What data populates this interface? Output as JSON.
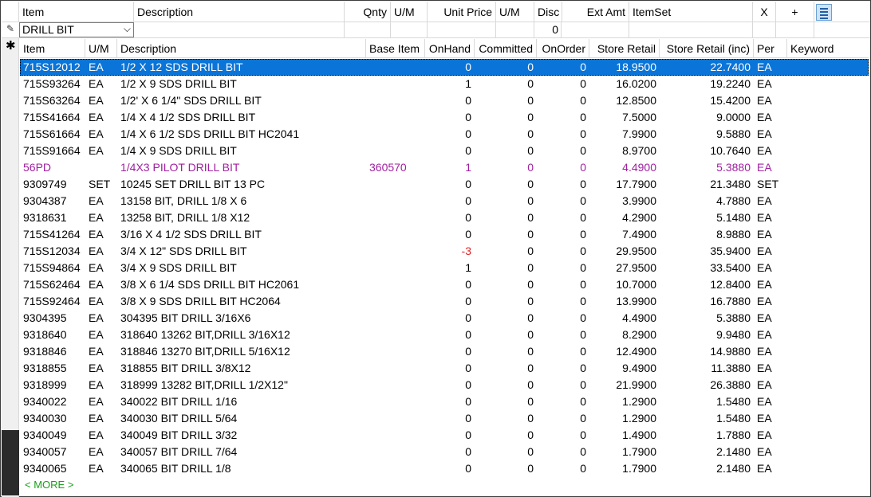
{
  "top_header": {
    "item": "Item",
    "description": "Description",
    "qnty": "Qnty",
    "um": "U/M",
    "unit_price": "Unit Price",
    "um2": "U/M",
    "disc": "Disc",
    "ext_amt": "Ext Amt",
    "itemset": "ItemSet",
    "close": "X",
    "add": "+",
    "menu_icon": "hamburger-menu-icon"
  },
  "entry": {
    "item_value": "DRILL BIT",
    "disc_value": "0"
  },
  "grid": {
    "columns": [
      "Item",
      "U/M",
      "Description",
      "Base Item",
      "OnHand",
      "Committed",
      "OnOrder",
      "Store Retail",
      "Store Retail (inc)",
      "Per",
      "Keyword"
    ],
    "rows": [
      {
        "item": "715S12012",
        "um": "EA",
        "desc": "1/2 X 12 SDS DRILL BIT",
        "base": "",
        "onhand": "0",
        "committed": "0",
        "onorder": "0",
        "retail": "18.9500",
        "retail_inc": "22.7400",
        "per": "EA",
        "keyword": ""
      },
      {
        "item": "715S93264",
        "um": "EA",
        "desc": "1/2 X 9 SDS DRILL BIT",
        "base": "",
        "onhand": "1",
        "committed": "0",
        "onorder": "0",
        "retail": "16.0200",
        "retail_inc": "19.2240",
        "per": "EA",
        "keyword": ""
      },
      {
        "item": "715S63264",
        "um": "EA",
        "desc": "1/2' X 6 1/4\" SDS DRILL BIT",
        "base": "",
        "onhand": "0",
        "committed": "0",
        "onorder": "0",
        "retail": "12.8500",
        "retail_inc": "15.4200",
        "per": "EA",
        "keyword": ""
      },
      {
        "item": "715S41664",
        "um": "EA",
        "desc": "1/4 X 4 1/2 SDS DRILL BIT",
        "base": "",
        "onhand": "0",
        "committed": "0",
        "onorder": "0",
        "retail": "7.5000",
        "retail_inc": "9.0000",
        "per": "EA",
        "keyword": ""
      },
      {
        "item": "715S61664",
        "um": "EA",
        "desc": "1/4 X 6 1/2 SDS DRILL BIT HC2041",
        "base": "",
        "onhand": "0",
        "committed": "0",
        "onorder": "0",
        "retail": "7.9900",
        "retail_inc": "9.5880",
        "per": "EA",
        "keyword": ""
      },
      {
        "item": "715S91664",
        "um": "EA",
        "desc": "1/4 X 9 SDS DRILL BIT",
        "base": "",
        "onhand": "0",
        "committed": "0",
        "onorder": "0",
        "retail": "8.9700",
        "retail_inc": "10.7640",
        "per": "EA",
        "keyword": ""
      },
      {
        "item": "56PD",
        "um": "",
        "desc": "1/4X3 PILOT DRILL BIT",
        "base": "360570",
        "onhand": "1",
        "committed": "0",
        "onorder": "0",
        "retail": "4.4900",
        "retail_inc": "5.3880",
        "per": "EA",
        "keyword": ""
      },
      {
        "item": "9309749",
        "um": "SET",
        "desc": "10245 SET DRILL BIT 13 PC",
        "base": "",
        "onhand": "0",
        "committed": "0",
        "onorder": "0",
        "retail": "17.7900",
        "retail_inc": "21.3480",
        "per": "SET",
        "keyword": ""
      },
      {
        "item": "9304387",
        "um": "EA",
        "desc": "13158 BIT, DRILL 1/8 X 6",
        "base": "",
        "onhand": "0",
        "committed": "0",
        "onorder": "0",
        "retail": "3.9900",
        "retail_inc": "4.7880",
        "per": "EA",
        "keyword": ""
      },
      {
        "item": "9318631",
        "um": "EA",
        "desc": "13258 BIT, DRILL 1/8 X12",
        "base": "",
        "onhand": "0",
        "committed": "0",
        "onorder": "0",
        "retail": "4.2900",
        "retail_inc": "5.1480",
        "per": "EA",
        "keyword": ""
      },
      {
        "item": "715S41264",
        "um": "EA",
        "desc": "3/16 X 4 1/2 SDS DRILL BIT",
        "base": "",
        "onhand": "0",
        "committed": "0",
        "onorder": "0",
        "retail": "7.4900",
        "retail_inc": "8.9880",
        "per": "EA",
        "keyword": ""
      },
      {
        "item": "715S12034",
        "um": "EA",
        "desc": "3/4 X 12\" SDS DRILL BIT",
        "base": "",
        "onhand": "-3",
        "committed": "0",
        "onorder": "0",
        "retail": "29.9500",
        "retail_inc": "35.9400",
        "per": "EA",
        "keyword": ""
      },
      {
        "item": "715S94864",
        "um": "EA",
        "desc": "3/4 X 9 SDS DRILL BIT",
        "base": "",
        "onhand": "1",
        "committed": "0",
        "onorder": "0",
        "retail": "27.9500",
        "retail_inc": "33.5400",
        "per": "EA",
        "keyword": ""
      },
      {
        "item": "715S62464",
        "um": "EA",
        "desc": "3/8 X 6 1/4 SDS DRILL BIT HC2061",
        "base": "",
        "onhand": "0",
        "committed": "0",
        "onorder": "0",
        "retail": "10.7000",
        "retail_inc": "12.8400",
        "per": "EA",
        "keyword": ""
      },
      {
        "item": "715S92464",
        "um": "EA",
        "desc": "3/8 X 9 SDS DRILL BIT HC2064",
        "base": "",
        "onhand": "0",
        "committed": "0",
        "onorder": "0",
        "retail": "13.9900",
        "retail_inc": "16.7880",
        "per": "EA",
        "keyword": ""
      },
      {
        "item": "9304395",
        "um": "EA",
        "desc": "304395 BIT DRILL 3/16X6",
        "base": "",
        "onhand": "0",
        "committed": "0",
        "onorder": "0",
        "retail": "4.4900",
        "retail_inc": "5.3880",
        "per": "EA",
        "keyword": ""
      },
      {
        "item": "9318640",
        "um": "EA",
        "desc": "318640 13262 BIT,DRILL 3/16X12",
        "base": "",
        "onhand": "0",
        "committed": "0",
        "onorder": "0",
        "retail": "8.2900",
        "retail_inc": "9.9480",
        "per": "EA",
        "keyword": ""
      },
      {
        "item": "9318846",
        "um": "EA",
        "desc": "318846 13270 BIT,DRILL 5/16X12",
        "base": "",
        "onhand": "0",
        "committed": "0",
        "onorder": "0",
        "retail": "12.4900",
        "retail_inc": "14.9880",
        "per": "EA",
        "keyword": ""
      },
      {
        "item": "9318855",
        "um": "EA",
        "desc": "318855 BIT DRILL 3/8X12",
        "base": "",
        "onhand": "0",
        "committed": "0",
        "onorder": "0",
        "retail": "9.4900",
        "retail_inc": "11.3880",
        "per": "EA",
        "keyword": ""
      },
      {
        "item": "9318999",
        "um": "EA",
        "desc": "318999 13282 BIT,DRILL 1/2X12\"",
        "base": "",
        "onhand": "0",
        "committed": "0",
        "onorder": "0",
        "retail": "21.9900",
        "retail_inc": "26.3880",
        "per": "EA",
        "keyword": ""
      },
      {
        "item": "9340022",
        "um": "EA",
        "desc": "340022 BIT DRILL 1/16",
        "base": "",
        "onhand": "0",
        "committed": "0",
        "onorder": "0",
        "retail": "1.2900",
        "retail_inc": "1.5480",
        "per": "EA",
        "keyword": ""
      },
      {
        "item": "9340030",
        "um": "EA",
        "desc": "340030 BIT DRILL 5/64",
        "base": "",
        "onhand": "0",
        "committed": "0",
        "onorder": "0",
        "retail": "1.2900",
        "retail_inc": "1.5480",
        "per": "EA",
        "keyword": ""
      },
      {
        "item": "9340049",
        "um": "EA",
        "desc": "340049 BIT DRILL 3/32",
        "base": "",
        "onhand": "0",
        "committed": "0",
        "onorder": "0",
        "retail": "1.4900",
        "retail_inc": "1.7880",
        "per": "EA",
        "keyword": ""
      },
      {
        "item": "9340057",
        "um": "EA",
        "desc": "340057 BIT DRILL 7/64",
        "base": "",
        "onhand": "0",
        "committed": "0",
        "onorder": "0",
        "retail": "1.7900",
        "retail_inc": "2.1480",
        "per": "EA",
        "keyword": ""
      },
      {
        "item": "9340065",
        "um": "EA",
        "desc": "340065 BIT DRILL 1/8",
        "base": "",
        "onhand": "0",
        "committed": "0",
        "onorder": "0",
        "retail": "1.7900",
        "retail_inc": "2.1480",
        "per": "EA",
        "keyword": ""
      }
    ],
    "selected_index": 0,
    "purple_index": 6,
    "more_label": "< MORE >"
  },
  "colors": {
    "selection": "#0a74d8",
    "highlight_row": "#a020a0",
    "negative": "#e02020",
    "more_link": "#1aa01a"
  }
}
